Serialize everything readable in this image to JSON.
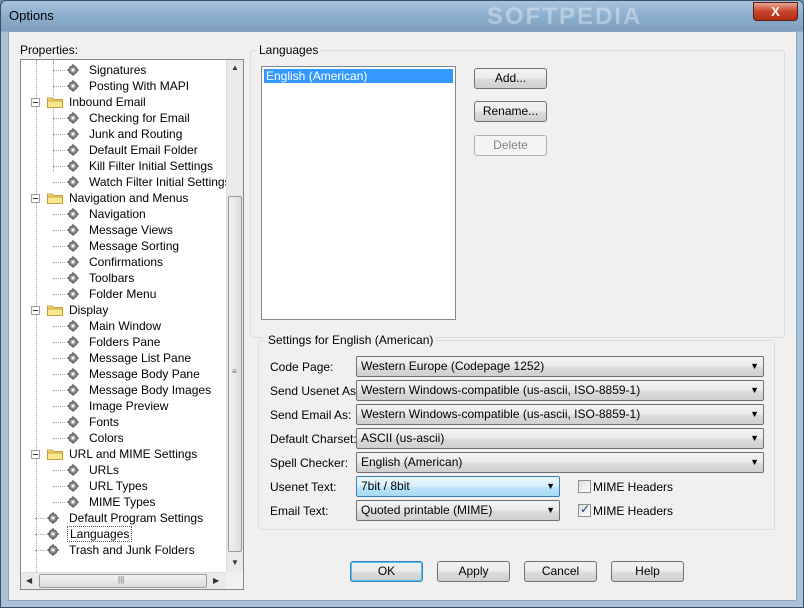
{
  "window": {
    "title": "Options",
    "watermark": "SOFTPEDIA",
    "close_glyph": "X"
  },
  "tree": {
    "header": "Properties:",
    "nodes": [
      {
        "label": "Signatures",
        "kind": "leaf"
      },
      {
        "label": "Posting With MAPI",
        "kind": "leaf"
      },
      {
        "label": "Inbound Email",
        "kind": "folder"
      },
      {
        "label": "Checking for Email",
        "kind": "leaf"
      },
      {
        "label": "Junk and Routing",
        "kind": "leaf"
      },
      {
        "label": "Default Email Folder",
        "kind": "leaf"
      },
      {
        "label": "Kill Filter Initial Settings",
        "kind": "leaf"
      },
      {
        "label": "Watch Filter Initial Settings",
        "kind": "leaf"
      },
      {
        "label": "Navigation and Menus",
        "kind": "folder"
      },
      {
        "label": "Navigation",
        "kind": "leaf"
      },
      {
        "label": "Message Views",
        "kind": "leaf"
      },
      {
        "label": "Message Sorting",
        "kind": "leaf"
      },
      {
        "label": "Confirmations",
        "kind": "leaf"
      },
      {
        "label": "Toolbars",
        "kind": "leaf"
      },
      {
        "label": "Folder Menu",
        "kind": "leaf"
      },
      {
        "label": "Display",
        "kind": "folder"
      },
      {
        "label": "Main Window",
        "kind": "leaf"
      },
      {
        "label": "Folders Pane",
        "kind": "leaf"
      },
      {
        "label": "Message List Pane",
        "kind": "leaf"
      },
      {
        "label": "Message Body Pane",
        "kind": "leaf"
      },
      {
        "label": "Message Body Images",
        "kind": "leaf"
      },
      {
        "label": "Image Preview",
        "kind": "leaf"
      },
      {
        "label": "Fonts",
        "kind": "leaf"
      },
      {
        "label": "Colors",
        "kind": "leaf"
      },
      {
        "label": "URL and MIME Settings",
        "kind": "folder"
      },
      {
        "label": "URLs",
        "kind": "leaf"
      },
      {
        "label": "URL Types",
        "kind": "leaf"
      },
      {
        "label": "MIME Types",
        "kind": "leaf"
      },
      {
        "label": "Default Program Settings",
        "kind": "top-leaf"
      },
      {
        "label": "Languages",
        "kind": "top-leaf",
        "selected": true
      },
      {
        "label": "Trash and Junk Folders",
        "kind": "top-leaf"
      }
    ]
  },
  "languages": {
    "group_label": "Languages",
    "items": [
      "English (American)"
    ],
    "add_label": "Add...",
    "rename_label": "Rename...",
    "delete_label": "Delete"
  },
  "settings": {
    "group_label": "Settings for English (American)",
    "code_page_label": "Code Page:",
    "code_page_value": "Western Europe (Codepage 1252)",
    "send_usenet_label": "Send Usenet As:",
    "send_usenet_value": "Western Windows-compatible (us-ascii, ISO-8859-1)",
    "send_email_label": "Send Email As:",
    "send_email_value": "Western Windows-compatible (us-ascii, ISO-8859-1)",
    "default_charset_label": "Default Charset:",
    "default_charset_value": "ASCII (us-ascii)",
    "spell_checker_label": "Spell Checker:",
    "spell_checker_value": "English (American)",
    "usenet_text_label": "Usenet Text:",
    "usenet_text_value": "7bit / 8bit",
    "email_text_label": "Email Text:",
    "email_text_value": "Quoted printable (MIME)",
    "mime_headers_label": "MIME Headers",
    "usenet_mime_checked": false,
    "email_mime_checked": true
  },
  "footer": {
    "ok_label": "OK",
    "apply_label": "Apply",
    "cancel_label": "Cancel",
    "help_label": "Help"
  },
  "colors": {
    "selection": "#3399ff",
    "dialog_bg": "#f0f0f0",
    "titlebar": "#8eb0cf",
    "close": "#c7432b"
  }
}
